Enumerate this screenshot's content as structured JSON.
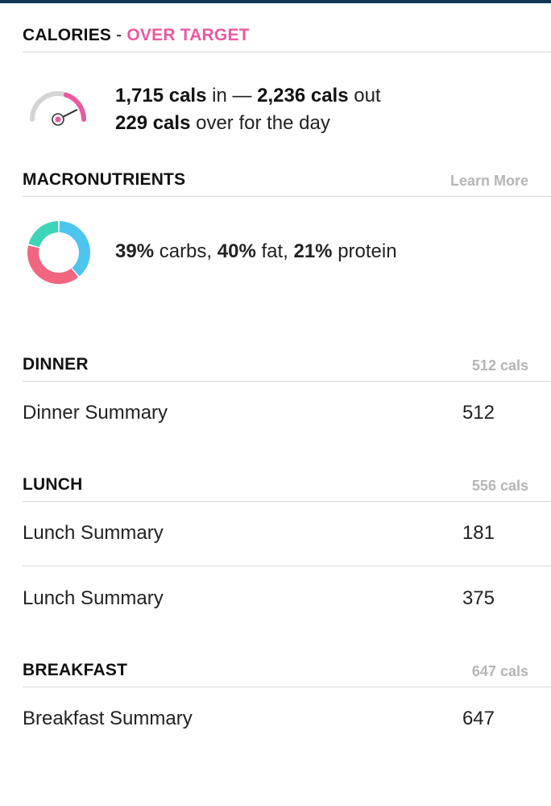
{
  "calories": {
    "title": "CALORIES",
    "separator": " - ",
    "status": "OVER TARGET",
    "in_value": "1,715 cals",
    "in_text": " in — ",
    "out_value": "2,236 cals",
    "out_text": " out",
    "over_value": "229 cals",
    "over_text": " over for the day",
    "gauge_level": 0.85,
    "accent_color": "#e95aa2"
  },
  "macronutrients": {
    "title": "MACRONUTRIENTS",
    "learn_more": "Learn More",
    "carbs_value": "39%",
    "carbs_text": " carbs, ",
    "fat_value": "40%",
    "fat_text": " fat, ",
    "protein_value": "21%",
    "protein_text": " protein",
    "split": {
      "carbs": 39,
      "fat": 40,
      "protein": 21
    },
    "colors": {
      "carbs": "#4dc5ee",
      "fat": "#f2657f",
      "protein": "#3ed4b8"
    }
  },
  "meals": [
    {
      "title": "DINNER",
      "total": "512 cals",
      "items": [
        {
          "name": "Dinner Summary",
          "value": "512"
        }
      ]
    },
    {
      "title": "LUNCH",
      "total": "556 cals",
      "items": [
        {
          "name": "Lunch Summary",
          "value": "181"
        },
        {
          "name": "Lunch Summary",
          "value": "375"
        }
      ]
    },
    {
      "title": "BREAKFAST",
      "total": "647 cals",
      "items": [
        {
          "name": "Breakfast Summary",
          "value": "647"
        }
      ]
    }
  ]
}
